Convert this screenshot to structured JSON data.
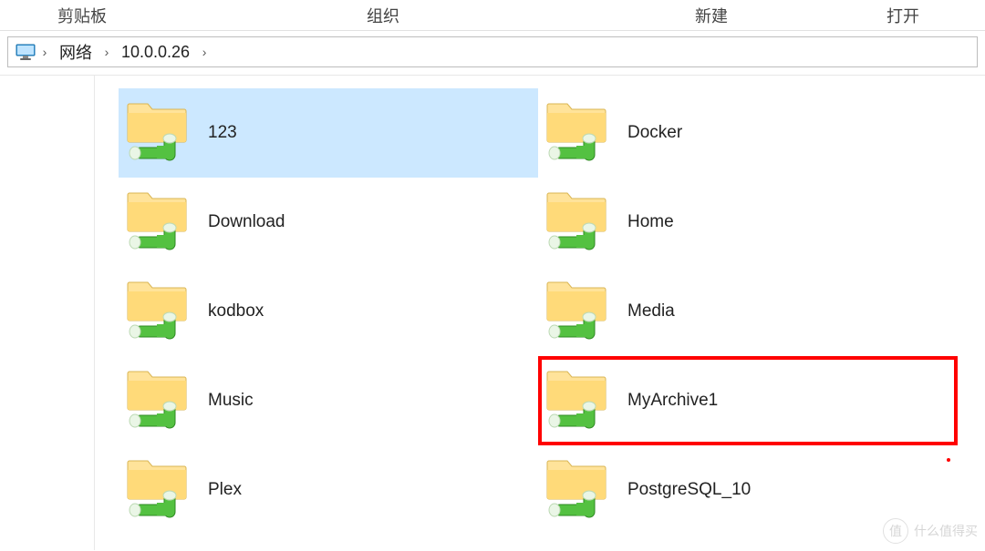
{
  "ribbon": {
    "groups": [
      "剪贴板",
      "组织",
      "新建",
      "打开"
    ]
  },
  "breadcrumb": {
    "root": "网络",
    "host": "10.0.0.26"
  },
  "folders": [
    {
      "name": "123",
      "selected": true,
      "highlight": false
    },
    {
      "name": "Docker",
      "selected": false,
      "highlight": false
    },
    {
      "name": "Download",
      "selected": false,
      "highlight": false
    },
    {
      "name": "Home",
      "selected": false,
      "highlight": false
    },
    {
      "name": "kodbox",
      "selected": false,
      "highlight": false
    },
    {
      "name": "Media",
      "selected": false,
      "highlight": false
    },
    {
      "name": "Music",
      "selected": false,
      "highlight": false
    },
    {
      "name": "MyArchive1",
      "selected": false,
      "highlight": true
    },
    {
      "name": "Plex",
      "selected": false,
      "highlight": false
    },
    {
      "name": "PostgreSQL_10",
      "selected": false,
      "highlight": false
    }
  ],
  "watermark": {
    "brand": "值",
    "text": "什么值得买"
  }
}
